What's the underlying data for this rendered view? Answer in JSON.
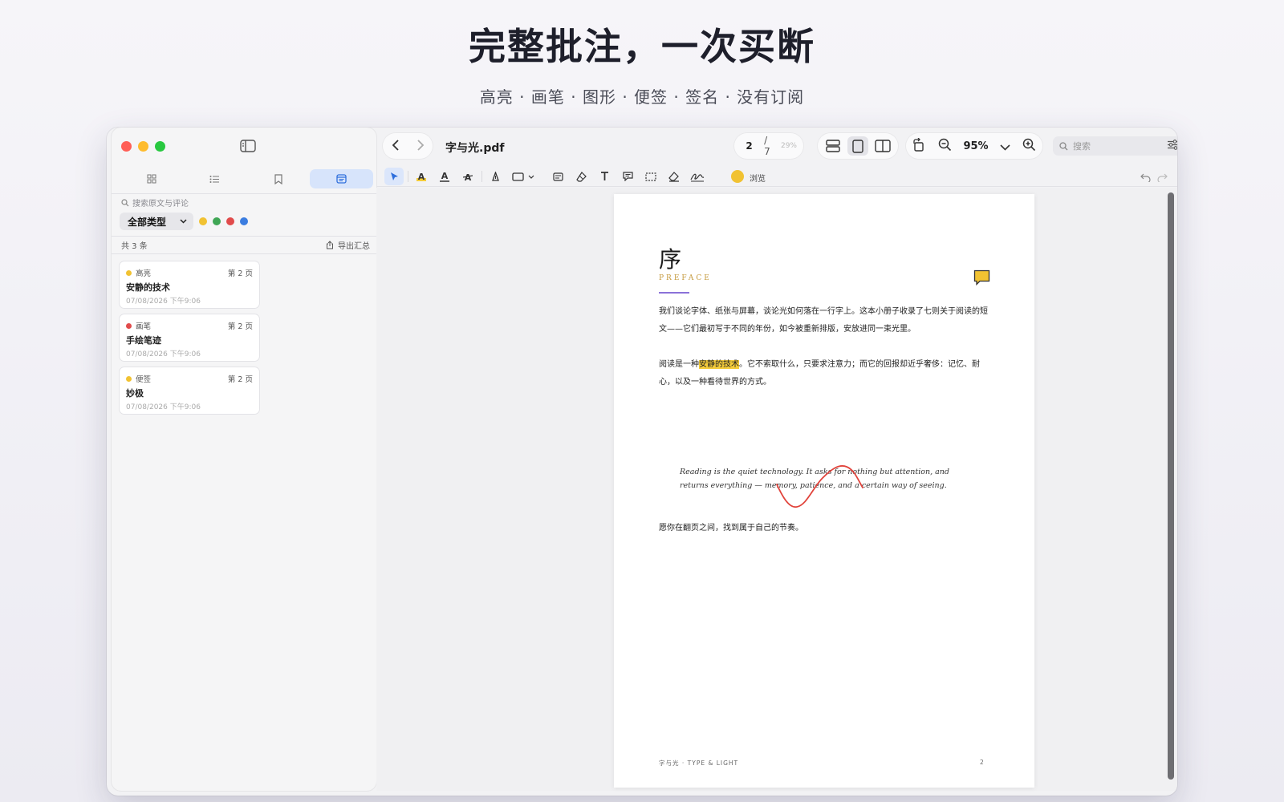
{
  "hero": {
    "title": "完整批注，一次买断",
    "subtitle": "高亮 · 画笔 · 图形 · 便签 · 签名 · 没有订阅"
  },
  "sidebar": {
    "search_placeholder": "搜索原文与评论",
    "type_filter": "全部类型",
    "color_filters": [
      "#f1c232",
      "#3fa655",
      "#e14b4b",
      "#3b7de0"
    ],
    "count_label": "共 3 条",
    "export_label": "导出汇总",
    "annotations": [
      {
        "type": "高亮",
        "color": "#f1c232",
        "page": "第 2 页",
        "text": "安静的技术",
        "date": "07/08/2026 下午9:06"
      },
      {
        "type": "画笔",
        "color": "#e14b4b",
        "page": "第 2 页",
        "text": "手绘笔迹",
        "date": "07/08/2026 下午9:06"
      },
      {
        "type": "便签",
        "color": "#f1c232",
        "page": "第 2 页",
        "text": "妙极",
        "date": "07/08/2026 下午9:06"
      }
    ]
  },
  "toolbar": {
    "file_name": "字与光.pdf",
    "page_current": "2",
    "page_total": "/ 7",
    "page_percent": "29%",
    "zoom": "95%",
    "search_placeholder": "搜索",
    "browse_label": "浏览"
  },
  "page": {
    "title": "序",
    "subtitle": "PREFACE",
    "para1": "我们谈论字体、纸张与屏幕，谈论光如何落在一行字上。这本小册子收录了七则关于阅读的短文——它们最初写于不同的年份，如今被重新排版，安放进同一束光里。",
    "para2_before": "阅读是一种",
    "para2_highlight": "安静的技术",
    "para2_after": "。它不索取什么，只要求注意力；而它的回报却近乎奢侈：记忆、耐心，以及一种看待世界的方式。",
    "quote": "Reading is the quiet technology. It asks for nothing but attention, and returns everything — memory, patience, and a certain way of seeing.",
    "closing": "愿你在翻页之间，找到属于自己的节奏。",
    "footer_left": "字与光 · TYPE & LIGHT",
    "footer_right": "2"
  }
}
